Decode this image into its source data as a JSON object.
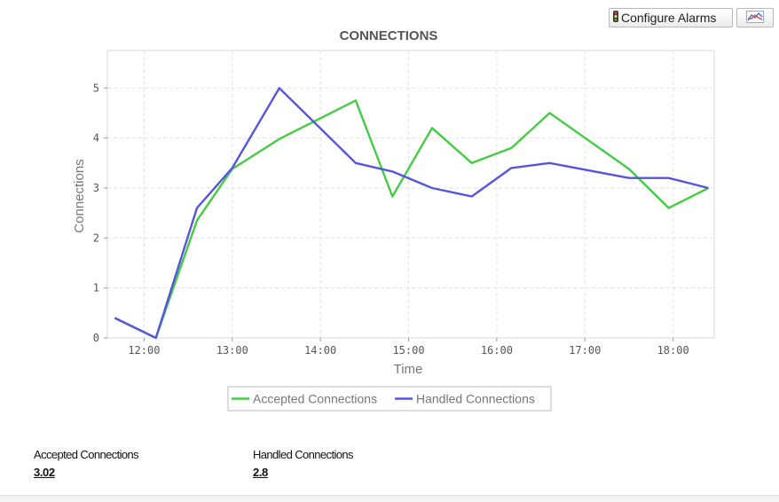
{
  "toolbar": {
    "configure_alarms_label": "Configure Alarms",
    "chart_options_icon": "line-chart-icon"
  },
  "chart_data": {
    "type": "line",
    "title": "CONNECTIONS",
    "xlabel": "Time",
    "ylabel": "Connections",
    "ylim": [
      0,
      5.75
    ],
    "yticks": [
      "0",
      "1",
      "2",
      "3",
      "4",
      "5"
    ],
    "xticks": [
      "12:00",
      "13:00",
      "14:00",
      "15:00",
      "16:00",
      "17:00",
      "18:00"
    ],
    "grid": true,
    "legend_position": "bottom",
    "series": [
      {
        "name": "Accepted Connections",
        "color": "#44cc44",
        "x": [
          "11:40",
          "12:08",
          "12:36",
          "13:00",
          "13:32",
          "14:24",
          "14:49",
          "15:16",
          "15:43",
          "16:10",
          "16:36",
          "17:30",
          "17:57",
          "18:24"
        ],
        "values": [
          0.4,
          0.0,
          2.35,
          3.38,
          3.98,
          4.75,
          2.83,
          4.2,
          3.5,
          3.8,
          4.5,
          3.38,
          2.6,
          3.0
        ]
      },
      {
        "name": "Handled Connections",
        "color": "#5555dd",
        "x": [
          "11:40",
          "12:08",
          "12:36",
          "13:00",
          "13:32",
          "14:24",
          "14:49",
          "15:16",
          "15:43",
          "16:10",
          "16:36",
          "17:30",
          "17:57",
          "18:24"
        ],
        "values": [
          0.4,
          0.0,
          2.6,
          3.4,
          5.0,
          3.5,
          3.33,
          3.0,
          2.83,
          3.4,
          3.5,
          3.2,
          3.2,
          3.0
        ]
      }
    ]
  },
  "summary": [
    {
      "label": "Accepted Connections",
      "value": "3.02"
    },
    {
      "label": "Handled Connections",
      "value": "2.8"
    }
  ]
}
